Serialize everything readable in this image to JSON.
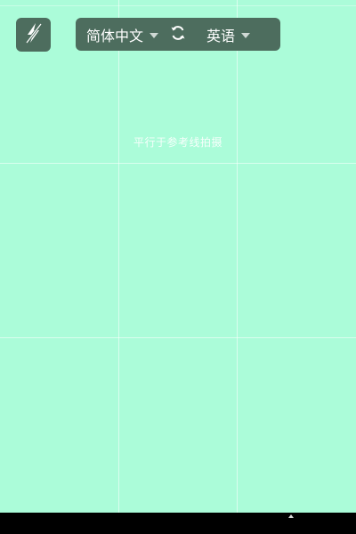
{
  "toolbar": {
    "flash_icon": "flash-off-icon",
    "source_language": "简体中文",
    "swap_icon": "swap-icon",
    "target_language": "英语",
    "dropdown_icon": "caret-down-icon"
  },
  "viewfinder": {
    "hint": "平行于参考线拍摄",
    "background_color": "#abfcd9",
    "grid": "3x3 reference lines"
  },
  "colors": {
    "control_background": "#4d6d5e",
    "text": "#ffffff",
    "nav_bar": "#000000"
  }
}
